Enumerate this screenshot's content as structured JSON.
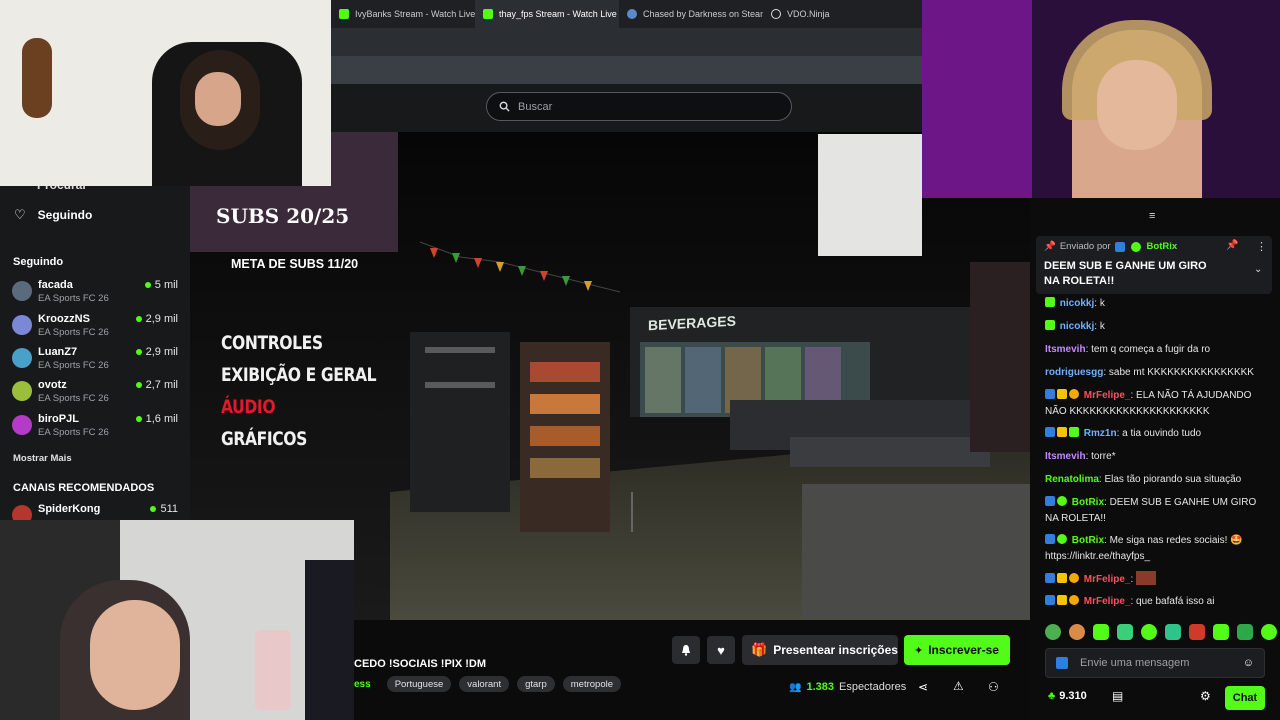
{
  "browser": {
    "tabs": [
      {
        "label": "IvyBanks Stream - Watch Live o",
        "active": false
      },
      {
        "label": "thay_fps Stream - Watch Live o",
        "active": true
      },
      {
        "label": "Chased by Darkness on Steam",
        "active": false
      },
      {
        "label": "VDO.Ninja",
        "active": false
      }
    ]
  },
  "header": {
    "search_placeholder": "Buscar"
  },
  "sidebar": {
    "cut_label": "Procurar",
    "following_nav": "Seguindo",
    "following_title": "Seguindo",
    "channels": [
      {
        "name": "facada",
        "game": "EA Sports FC 26",
        "viewers": "5 mil",
        "color": "#5a6b7d"
      },
      {
        "name": "KroozzNS",
        "game": "EA Sports FC 26",
        "viewers": "2,9 mil",
        "color": "#7b88d6"
      },
      {
        "name": "LuanZ7",
        "game": "EA Sports FC 26",
        "viewers": "2,9 mil",
        "color": "#49a0c9"
      },
      {
        "name": "ovotz",
        "game": "EA Sports FC 26",
        "viewers": "2,7 mil",
        "color": "#9bbf3d"
      },
      {
        "name": "biroPJL",
        "game": "EA Sports FC 26",
        "viewers": "1,6 mil",
        "color": "#b43ac8"
      }
    ],
    "show_more": "Mostrar Mais",
    "recommended_title": "CANAIS RECOMENDADOS",
    "recommended": [
      {
        "name": "SpiderKong",
        "viewers": "511"
      }
    ]
  },
  "stream": {
    "subs_goal": "SUBS 20/25",
    "subs_meta": "META DE SUBS 11/20",
    "menu": [
      {
        "label": "CONTROLES",
        "color": "#f1f1f1"
      },
      {
        "label": "EXIBIÇÃO E GERAL",
        "color": "#f1f1f1"
      },
      {
        "label": "ÁUDIO",
        "color": "#e0192b"
      },
      {
        "label": "GRÁFICOS",
        "color": "#f1f1f1"
      }
    ],
    "store_sign": "BEVERAGES",
    "title": "CEDO !SOCIAIS !PIX !DM",
    "category_cut": "ess",
    "tags": [
      "Portuguese",
      "valorant",
      "gtarp",
      "metropole"
    ],
    "viewers_count": "1.383",
    "viewers_label": "Espectadores",
    "gift_button": "Presentear inscrições",
    "subscribe_button": "Inscrever-se"
  },
  "chat": {
    "pinned_prefix": "Enviado por",
    "pinned_user": "BotRix",
    "pinned_message": "DEEM SUB E GANHE UM GIRO NA ROLETA!!",
    "messages": [
      {
        "user": "nicokkj",
        "text": "k",
        "color": "u-blue",
        "badges": [
          "#53fc18"
        ]
      },
      {
        "user": "nicokkj",
        "text": "k",
        "color": "u-blue",
        "badges": [
          "#53fc18"
        ]
      },
      {
        "user": "Itsmevih",
        "text": "tem q começa a fugir da ro",
        "color": "u-purple",
        "badges": []
      },
      {
        "user": "rodriguesgg",
        "text": "sabe mt KKKKKKKKKKKKKKKK",
        "color": "u-blue",
        "badges": []
      },
      {
        "user": "MrFelipe_",
        "text": "ELA NÃO TÁ AJUDANDO NÃO KKKKKKKKKKKKKKKKKKKKK",
        "color": "u-red",
        "badges": [
          "#2f7fe0",
          "#f5c400",
          "#f5a800"
        ]
      },
      {
        "user": "Rmz1n",
        "text": "a tia ouvindo tudo",
        "color": "u-blue",
        "badges": [
          "#2f7fe0",
          "#f5c400",
          "#53fc18"
        ]
      },
      {
        "user": "Itsmevih",
        "text": "torre*",
        "color": "u-purple",
        "badges": []
      },
      {
        "user": "Renatolima",
        "text": "Elas tão piorando sua situação",
        "color": "u-green",
        "badges": []
      },
      {
        "user": "BotRix",
        "text": "DEEM SUB E GANHE UM GIRO NA ROLETA!!",
        "color": "u-green",
        "badges": [
          "#2f7fe0",
          "#53fc18"
        ]
      },
      {
        "user": "BotRix",
        "text": "Me siga nas redes sociais! 🤩 https://linktr.ee/thayfps_",
        "color": "u-green",
        "badges": [
          "#2f7fe0",
          "#53fc18"
        ]
      },
      {
        "user": "MrFelipe_",
        "text": "",
        "color": "u-red",
        "badges": [
          "#2f7fe0",
          "#f5c400",
          "#f5a800"
        ]
      },
      {
        "user": "MrFelipe_",
        "text": "que bafafá isso ai",
        "color": "u-red",
        "badges": [
          "#2f7fe0",
          "#f5c400",
          "#f5a800"
        ]
      }
    ],
    "input_placeholder": "Envie uma mensagem",
    "points": "9.310",
    "send_button": "Chat"
  },
  "colors": {
    "accent": "#53fc18",
    "chat_bg": "#0c0c0d",
    "sidebar_bg": "#18191b"
  }
}
